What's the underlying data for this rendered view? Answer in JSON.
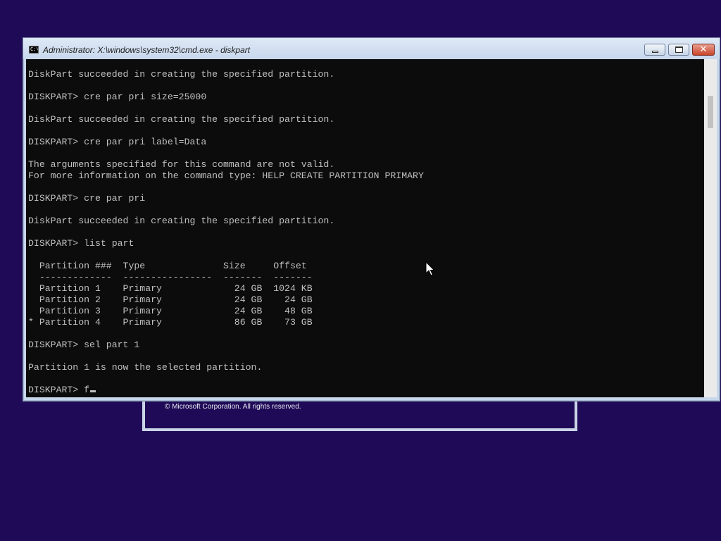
{
  "setup": {
    "copyright": "© Microsoft Corporation. All rights reserved."
  },
  "window": {
    "title": "Administrator: X:\\windows\\system32\\cmd.exe - diskpart",
    "icon": "cmd-icon",
    "close_glyph": "✕"
  },
  "console": {
    "lines": [
      "DiskPart succeeded in creating the specified partition.",
      "",
      "DISKPART> cre par pri size=25000",
      "",
      "DiskPart succeeded in creating the specified partition.",
      "",
      "DISKPART> cre par pri label=Data",
      "",
      "The arguments specified for this command are not valid.",
      "For more information on the command type: HELP CREATE PARTITION PRIMARY",
      "",
      "DISKPART> cre par pri",
      "",
      "DiskPart succeeded in creating the specified partition.",
      "",
      "DISKPART> list part",
      "",
      "  Partition ###  Type              Size     Offset",
      "  -------------  ----------------  -------  -------",
      "  Partition 1    Primary             24 GB  1024 KB",
      "  Partition 2    Primary             24 GB    24 GB",
      "  Partition 3    Primary             24 GB    48 GB",
      "* Partition 4    Primary             86 GB    73 GB",
      "",
      "DISKPART> sel part 1",
      "",
      "Partition 1 is now the selected partition.",
      ""
    ],
    "prompt": "DISKPART> f"
  }
}
